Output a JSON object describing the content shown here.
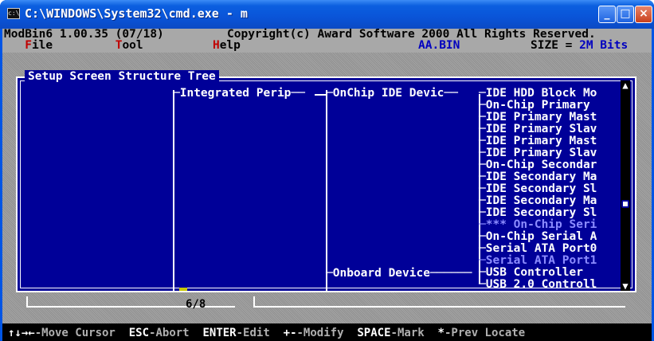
{
  "window": {
    "title": "C:\\WINDOWS\\System32\\cmd.exe - m",
    "icon": "console-icon",
    "minimize": "_",
    "maximize": "□",
    "close": "×"
  },
  "header": {
    "version": "ModBin6 1.00.35 (07/18)",
    "copyright": "Copyright(c) Award Software 2000 All Rights Reserved."
  },
  "menu": {
    "file_hot": "F",
    "file_rest": "ile",
    "tool_hot": "T",
    "tool_rest": "ool",
    "help_hot": "H",
    "help_rest": "elp"
  },
  "file_name": "AA.BIN",
  "size_label": "SIZE = ",
  "size_value": "2M Bits",
  "panel_title": "Setup Screen Structure Tree",
  "tree": {
    "level1": "Integrated Perip",
    "level2_selected": "OnChip IDE Devic",
    "level2_onboard": "Onboard Device",
    "items": [
      {
        "label": "IDE HDD Block Mo",
        "dim": false
      },
      {
        "label": "On-Chip Primary ",
        "dim": false
      },
      {
        "label": "IDE Primary Mast",
        "dim": false
      },
      {
        "label": "IDE Primary Slav",
        "dim": false
      },
      {
        "label": "IDE Primary Mast",
        "dim": false
      },
      {
        "label": "IDE Primary Slav",
        "dim": false
      },
      {
        "label": "On-Chip Secondar",
        "dim": false
      },
      {
        "label": "IDE Secondary Ma",
        "dim": false
      },
      {
        "label": "IDE Secondary Sl",
        "dim": false
      },
      {
        "label": "IDE Secondary Ma",
        "dim": false
      },
      {
        "label": "IDE Secondary Sl",
        "dim": false
      },
      {
        "label": "*** On-Chip Seri",
        "dim": true
      },
      {
        "label": "On-Chip Serial A",
        "dim": false
      },
      {
        "label": "Serial ATA Port0",
        "dim": false
      },
      {
        "label": "Serial ATA Port1",
        "dim": true
      },
      {
        "label": "USB Controller",
        "dim": false
      },
      {
        "label": "USB 2.0 Controll",
        "dim": false
      }
    ]
  },
  "scrollbar": {
    "up": "▲",
    "down": "▼"
  },
  "page_indicator": "6/8",
  "statusbar": {
    "move_key": "↑↓→←",
    "move_desc": "-Move Cursor",
    "esc_key": "ESC",
    "esc_desc": "-Abort",
    "enter_key": "ENTER",
    "enter_desc": "-Edit",
    "modify_key": "+-",
    "modify_desc": "-Modify",
    "space_key": "SPACE",
    "space_desc": "-Mark",
    "prev_key": "*",
    "prev_desc": "-Prev Locate"
  },
  "colors": {
    "panel_bg": "#000098",
    "selection": "#c8c800",
    "titlebar": "#0a54d8",
    "hotkey": "#c00000"
  }
}
